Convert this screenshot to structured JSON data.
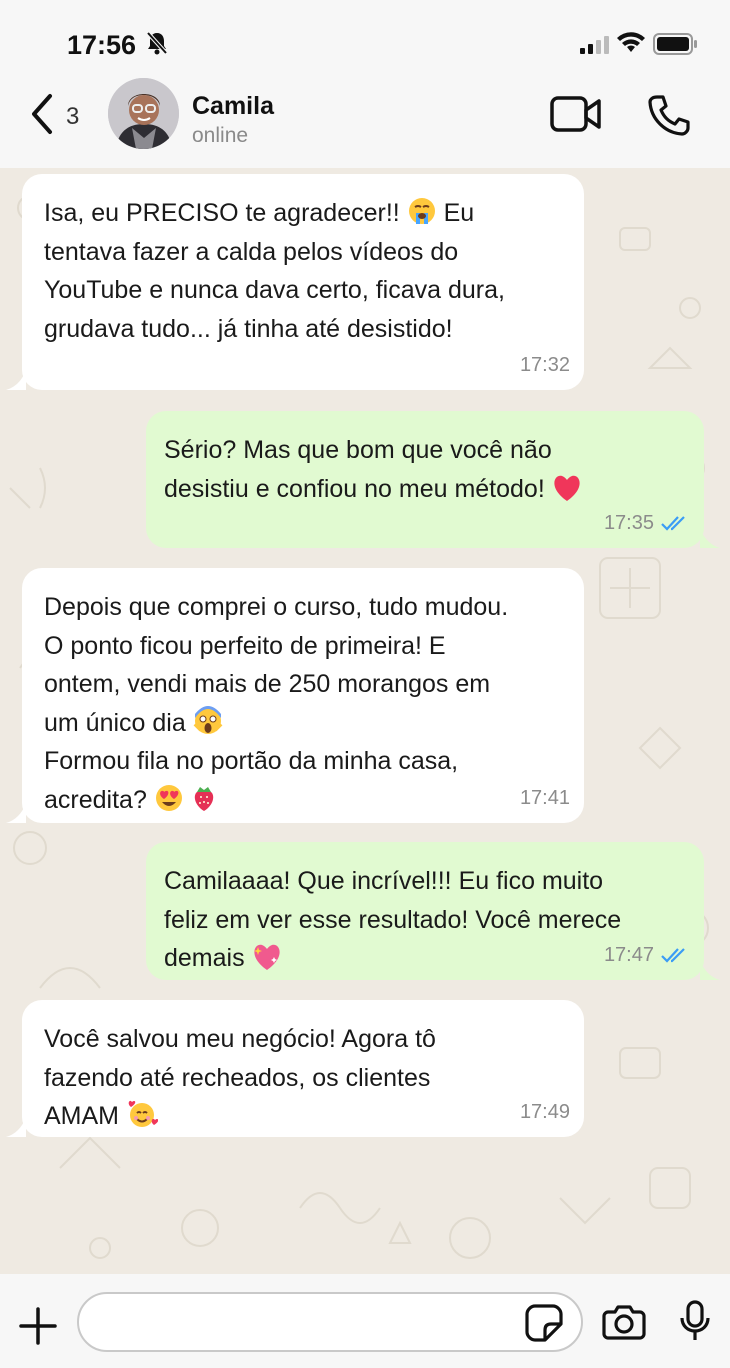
{
  "status_bar": {
    "time": "17:56"
  },
  "header": {
    "back_count": "3",
    "contact_name": "Camila",
    "contact_status": "online"
  },
  "messages": [
    {
      "direction": "in",
      "text_parts": [
        "Isa, eu PRECISO te agradecer!! ",
        " Eu\ntentava fazer a calda pelos vídeos do\nYouTube e nunca dava certo, ficava dura,\ngrudava tudo... já tinha até desistido!"
      ],
      "emojis": [
        "loudly-crying-face-emoji"
      ],
      "time": "17:32"
    },
    {
      "direction": "out",
      "text_parts": [
        "Sério? Mas que bom que você não\ndesistiu e confiou no meu método! "
      ],
      "emojis": [
        "red-heart-emoji"
      ],
      "time": "17:35",
      "status": "read"
    },
    {
      "direction": "in",
      "text_parts": [
        "Depois que comprei o curso, tudo mudou.\nO ponto ficou perfeito de primeira! E\nontem, vendi mais de 250 morangos em\num único dia ",
        "\nFormou fila no portão da minha casa,\nacredita? ",
        " "
      ],
      "emojis": [
        "screaming-face-emoji",
        "heart-eyes-emoji",
        "strawberry-emoji"
      ],
      "time": "17:41"
    },
    {
      "direction": "out",
      "text_parts": [
        "Camilaaaa! Que incrível!!! Eu fico muito\nfeliz em ver esse resultado! Você merece\ndemais "
      ],
      "emojis": [
        "sparkling-heart-emoji"
      ],
      "time": "17:47",
      "status": "read"
    },
    {
      "direction": "in",
      "text_parts": [
        "Você salvou meu negócio! Agora tô\nfazendo até recheados, os clientes\nAMAM "
      ],
      "emojis": [
        "smiling-face-with-hearts-emoji"
      ],
      "time": "17:49"
    }
  ],
  "composer": {
    "placeholder": ""
  },
  "colors": {
    "incoming_bubble": "#ffffff",
    "outgoing_bubble": "#e1fad1",
    "chat_background": "#efeae2",
    "read_ticks": "#3b9cf5"
  }
}
